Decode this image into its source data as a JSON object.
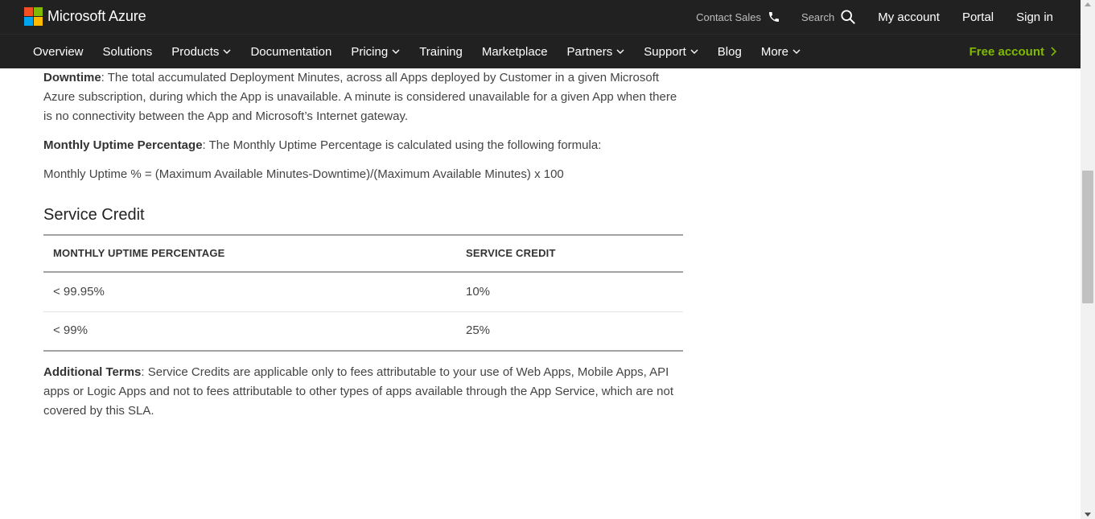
{
  "header": {
    "brand": "Microsoft Azure",
    "logo_colors": [
      "#f25022",
      "#7fba00",
      "#00a4ef",
      "#ffb900"
    ],
    "contact_sales": "Contact Sales",
    "search": "Search",
    "my_account": "My account",
    "portal": "Portal",
    "sign_in": "Sign in",
    "icons": [
      "phone-icon",
      "search-icon"
    ]
  },
  "nav": {
    "items": [
      {
        "label": "Overview",
        "dropdown": false
      },
      {
        "label": "Solutions",
        "dropdown": false
      },
      {
        "label": "Products",
        "dropdown": true
      },
      {
        "label": "Documentation",
        "dropdown": false
      },
      {
        "label": "Pricing",
        "dropdown": true
      },
      {
        "label": "Training",
        "dropdown": false
      },
      {
        "label": "Marketplace",
        "dropdown": false
      },
      {
        "label": "Partners",
        "dropdown": true
      },
      {
        "label": "Support",
        "dropdown": true
      },
      {
        "label": "Blog",
        "dropdown": false
      },
      {
        "label": "More",
        "dropdown": true
      }
    ],
    "free_account": "Free account",
    "free_account_color": "#7fba00"
  },
  "content": {
    "downtime_term": "Downtime",
    "downtime_text": ": The total accumulated Deployment Minutes, across all Apps deployed by Customer in a given Microsoft Azure subscription, during which the App is unavailable. A minute is considered unavailable for a given App when there is no connectivity between the App and Microsoft’s Internet gateway.",
    "uptime_term": "Monthly Uptime Percentage",
    "uptime_text": ": The Monthly Uptime Percentage is calculated using the following formula:",
    "formula": "Monthly Uptime % = (Maximum Available Minutes-Downtime)/(Maximum Available Minutes) x 100",
    "service_credit_heading": "Service Credit",
    "table": {
      "headers": [
        "MONTHLY UPTIME PERCENTAGE",
        "SERVICE CREDIT"
      ],
      "rows": [
        [
          "< 99.95%",
          "10%"
        ],
        [
          "< 99%",
          "25%"
        ]
      ]
    },
    "additional_term": "Additional Terms",
    "additional_text": ": Service Credits are applicable only to fees attributable to your use of Web Apps, Mobile Apps, API apps or Logic Apps and not to fees attributable to other types of apps available through the App Service, which are not covered by this SLA."
  }
}
